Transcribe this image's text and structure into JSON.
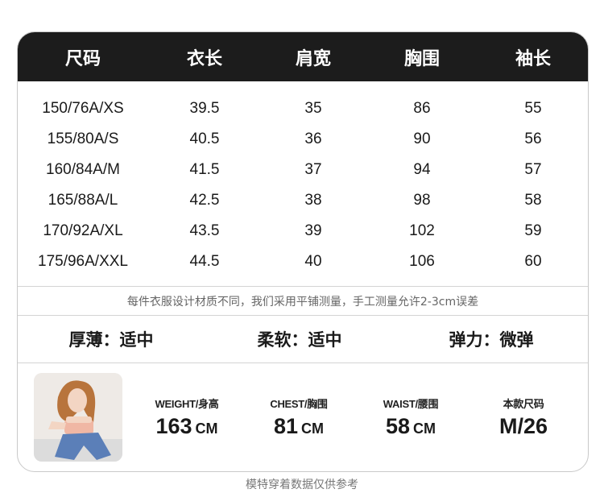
{
  "header": [
    "尺码",
    "衣长",
    "肩宽",
    "胸围",
    "袖长"
  ],
  "rows": [
    [
      "150/76A/XS",
      "39.5",
      "35",
      "86",
      "55"
    ],
    [
      "155/80A/S",
      "40.5",
      "36",
      "90",
      "56"
    ],
    [
      "160/84A/M",
      "41.5",
      "37",
      "94",
      "57"
    ],
    [
      "165/88A/L",
      "42.5",
      "38",
      "98",
      "58"
    ],
    [
      "170/92A/XL",
      "43.5",
      "39",
      "102",
      "59"
    ],
    [
      "175/96A/XXL",
      "44.5",
      "40",
      "106",
      "60"
    ]
  ],
  "note": "每件衣服设计材质不同，我们采用平铺测量，手工测量允许2-3cm误差",
  "traits": [
    "厚薄：适中",
    "柔软：适中",
    "弹力：微弹"
  ],
  "model": {
    "weight_label": "WEIGHT/身高",
    "weight_value": "163",
    "weight_unit": "CM",
    "chest_label": "CHEST/胸围",
    "chest_value": "81",
    "chest_unit": "CM",
    "waist_label": "WAIST/腰围",
    "waist_value": "58",
    "waist_unit": "CM",
    "size_label": "本款尺码",
    "size_value": "M/26"
  },
  "caption": "模特穿着数据仅供参考",
  "colors": {
    "header_bg": "#1c1c1c",
    "header_text": "#ffffff",
    "border": "#c9c9c9"
  }
}
